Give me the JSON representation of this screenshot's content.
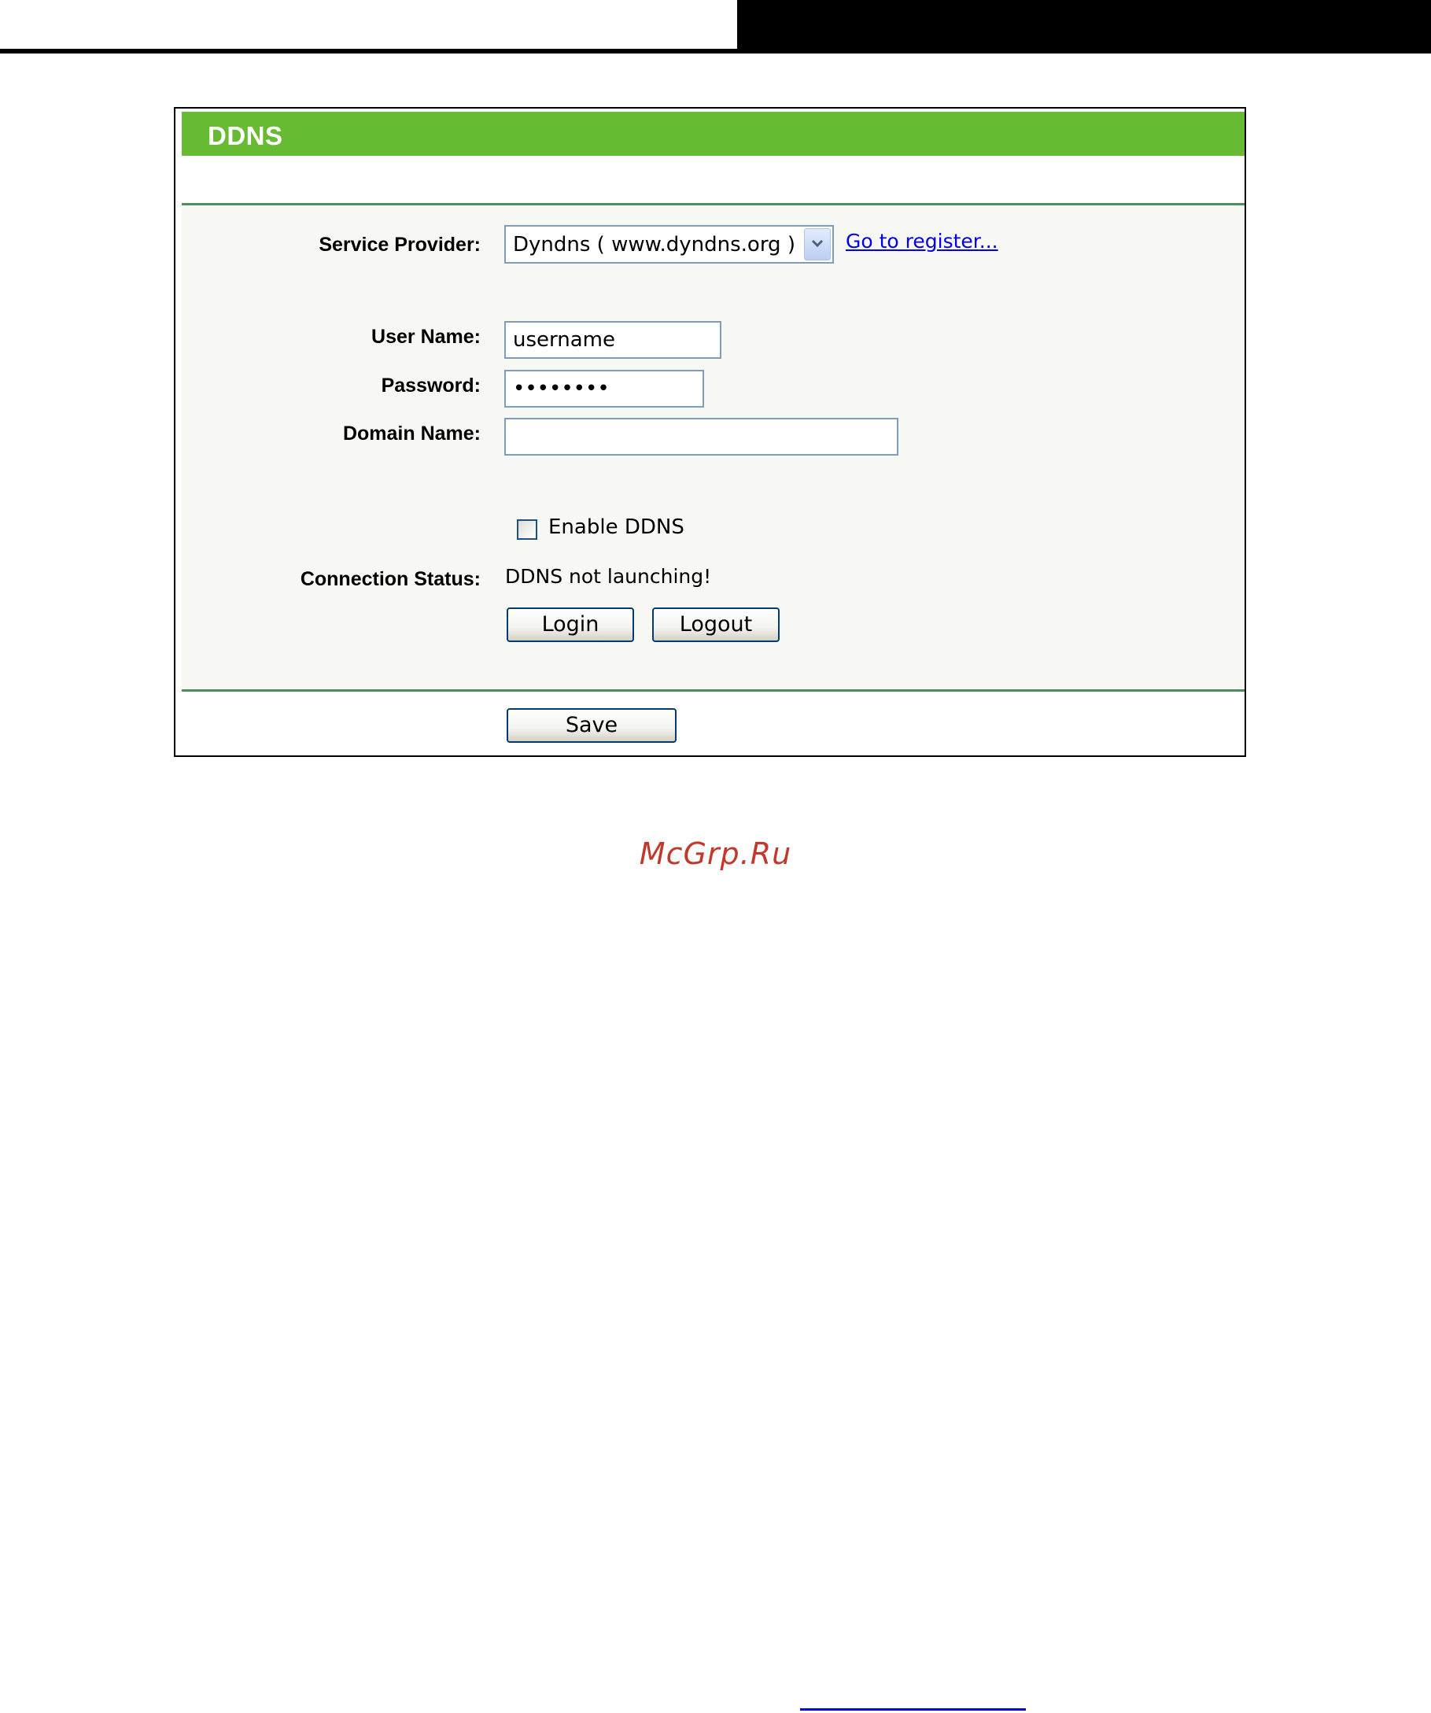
{
  "panel": {
    "title": "DDNS"
  },
  "form": {
    "service_provider_label": "Service Provider:",
    "service_provider_value": "Dyndns ( www.dyndns.org )",
    "register_link": "Go to register...",
    "user_name_label": "User Name:",
    "user_name_value": "username",
    "password_label": "Password:",
    "password_value": "••••••••",
    "domain_name_label": "Domain Name:",
    "domain_name_value": "",
    "enable_label": "Enable DDNS",
    "enable_checked": false,
    "connection_status_label": "Connection Status:",
    "connection_status_value": "DDNS not launching!",
    "login_label": "Login",
    "logout_label": "Logout",
    "save_label": "Save"
  },
  "watermark": "McGrp.Ru",
  "colors": {
    "header_green": "#66bb33",
    "divider_green": "#4d8f5c",
    "link_blue": "#0000ee",
    "watermark_red": "#c0392b"
  }
}
